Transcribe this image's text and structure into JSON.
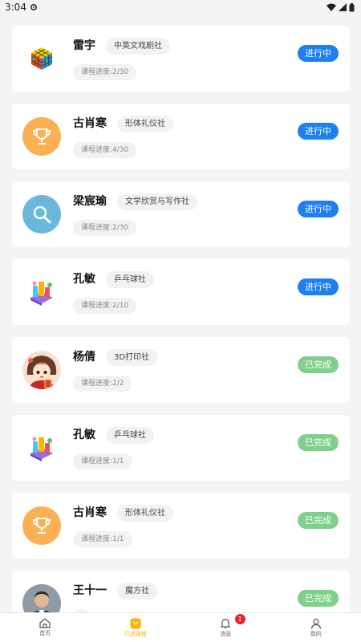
{
  "status_bar": {
    "time": "3:04"
  },
  "cards": [
    {
      "name": "雷宇",
      "club": "中英文戏剧社",
      "progress": "课程进度:2/30",
      "status": "进行中",
      "state": "running",
      "avatar_icon": "rubiks-cube-icon"
    },
    {
      "name": "古肖寒",
      "club": "形体礼仪社",
      "progress": "课程进度:4/30",
      "status": "进行中",
      "state": "running",
      "avatar_icon": "trophy-icon"
    },
    {
      "name": "梁宸瑜",
      "club": "文学欣赏与写作社",
      "progress": "课程进度:2/30",
      "status": "进行中",
      "state": "running",
      "avatar_icon": "magnifier-icon"
    },
    {
      "name": "孔敏",
      "club": "乒乓球社",
      "progress": "课程进度:2/10",
      "status": "进行中",
      "state": "running",
      "avatar_icon": "isometric-city-icon"
    },
    {
      "name": "杨倩",
      "club": "3D打印社",
      "progress": "课程进度:2/2",
      "status": "已完成",
      "state": "done",
      "avatar_icon": "cartoon-girl-avatar"
    },
    {
      "name": "孔敏",
      "club": "乒乓球社",
      "progress": "课程进度:1/1",
      "status": "已完成",
      "state": "done",
      "avatar_icon": "isometric-city-icon"
    },
    {
      "name": "古肖寒",
      "club": "形体礼仪社",
      "progress": "课程进度:1/1",
      "status": "已完成",
      "state": "done",
      "avatar_icon": "trophy-icon"
    },
    {
      "name": "王十一",
      "club": "魔方社",
      "progress": "",
      "status": "已完成",
      "state": "done",
      "avatar_icon": "man-photo-avatar"
    }
  ],
  "tabbar": {
    "home": "首页",
    "courses": "已选课程",
    "messages": "消息",
    "messages_badge": "1",
    "mine": "我的"
  },
  "colors": {
    "running": "#1e7ff0",
    "done": "#7ed08a",
    "active_tab": "#f7b500"
  }
}
